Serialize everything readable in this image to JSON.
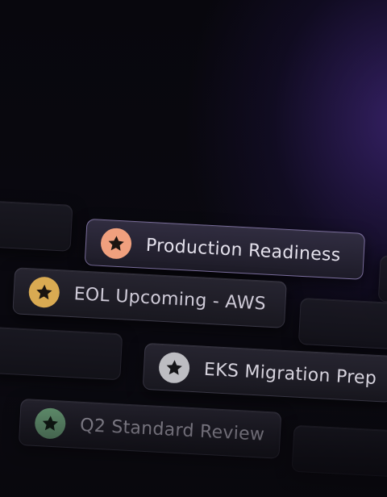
{
  "tags": [
    {
      "label": "Production Readiness",
      "badge_color": "#f0a07e",
      "text_color": "#e4e1ec"
    },
    {
      "label": "EOL Upcoming - AWS",
      "badge_color": "#d9aa52",
      "text_color": "#cfcbd8"
    },
    {
      "label": "EKS Migration Prep",
      "badge_color": "#bdbdc2",
      "text_color": "#d6d3dd"
    },
    {
      "label": "Q2 Standard Review",
      "badge_color": "#6fa57d",
      "text_color": "#a9a6b2"
    }
  ],
  "icon": "star-icon"
}
